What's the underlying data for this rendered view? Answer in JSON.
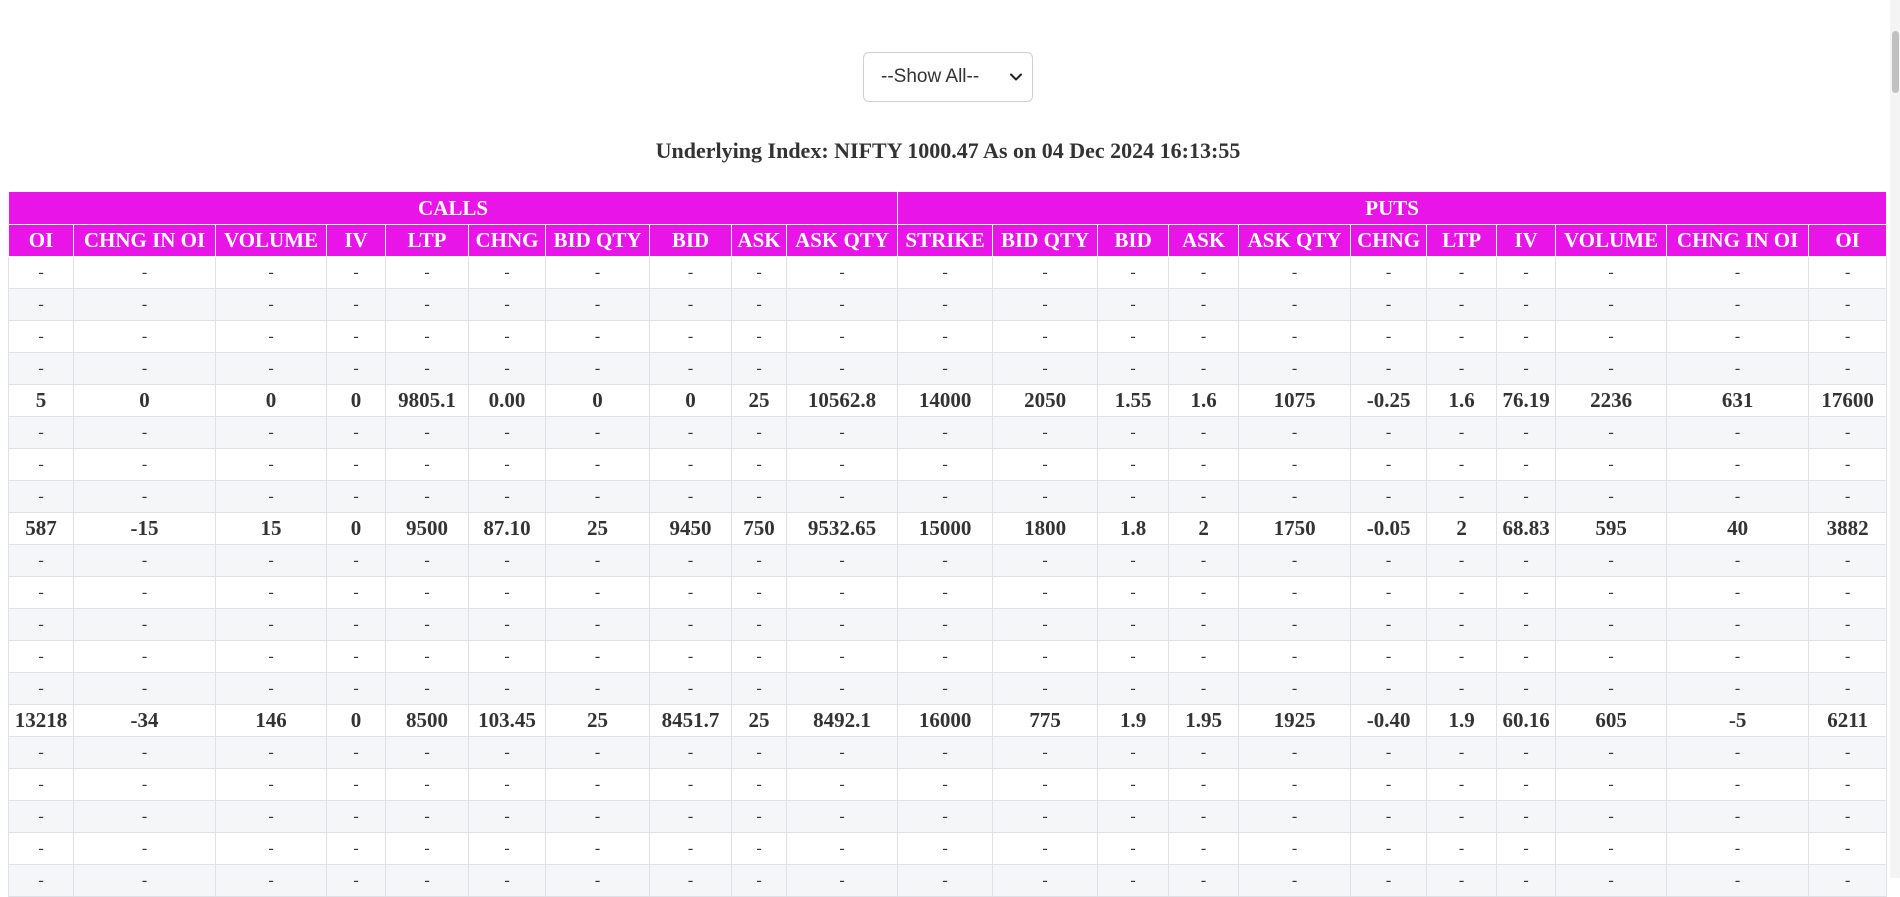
{
  "filter": {
    "selected": "--Show All--"
  },
  "title": "Underlying Index: NIFTY 1000.47 As on 04 Dec 2024 16:13:55",
  "table": {
    "groups": [
      "CALLS",
      "PUTS"
    ],
    "columns": [
      "OI",
      "CHNG IN OI",
      "VOLUME",
      "IV",
      "LTP",
      "CHNG",
      "BID QTY",
      "BID",
      "ASK",
      "ASK QTY",
      "STRIKE",
      "BID QTY",
      "BID",
      "ASK",
      "ASK QTY",
      "CHNG",
      "LTP",
      "IV",
      "VOLUME",
      "CHNG IN OI",
      "OI"
    ],
    "rows": [
      [
        "-",
        "-",
        "-",
        "-",
        "-",
        "-",
        "-",
        "-",
        "-",
        "-",
        "-",
        "-",
        "-",
        "-",
        "-",
        "-",
        "-",
        "-",
        "-",
        "-",
        "-"
      ],
      [
        "-",
        "-",
        "-",
        "-",
        "-",
        "-",
        "-",
        "-",
        "-",
        "-",
        "-",
        "-",
        "-",
        "-",
        "-",
        "-",
        "-",
        "-",
        "-",
        "-",
        "-"
      ],
      [
        "-",
        "-",
        "-",
        "-",
        "-",
        "-",
        "-",
        "-",
        "-",
        "-",
        "-",
        "-",
        "-",
        "-",
        "-",
        "-",
        "-",
        "-",
        "-",
        "-",
        "-"
      ],
      [
        "-",
        "-",
        "-",
        "-",
        "-",
        "-",
        "-",
        "-",
        "-",
        "-",
        "-",
        "-",
        "-",
        "-",
        "-",
        "-",
        "-",
        "-",
        "-",
        "-",
        "-"
      ],
      [
        "5",
        "0",
        "0",
        "0",
        "9805.1",
        "0.00",
        "0",
        "0",
        "25",
        "10562.8",
        "14000",
        "2050",
        "1.55",
        "1.6",
        "1075",
        "-0.25",
        "1.6",
        "76.19",
        "2236",
        "631",
        "17600"
      ],
      [
        "-",
        "-",
        "-",
        "-",
        "-",
        "-",
        "-",
        "-",
        "-",
        "-",
        "-",
        "-",
        "-",
        "-",
        "-",
        "-",
        "-",
        "-",
        "-",
        "-",
        "-"
      ],
      [
        "-",
        "-",
        "-",
        "-",
        "-",
        "-",
        "-",
        "-",
        "-",
        "-",
        "-",
        "-",
        "-",
        "-",
        "-",
        "-",
        "-",
        "-",
        "-",
        "-",
        "-"
      ],
      [
        "-",
        "-",
        "-",
        "-",
        "-",
        "-",
        "-",
        "-",
        "-",
        "-",
        "-",
        "-",
        "-",
        "-",
        "-",
        "-",
        "-",
        "-",
        "-",
        "-",
        "-"
      ],
      [
        "587",
        "-15",
        "15",
        "0",
        "9500",
        "87.10",
        "25",
        "9450",
        "750",
        "9532.65",
        "15000",
        "1800",
        "1.8",
        "2",
        "1750",
        "-0.05",
        "2",
        "68.83",
        "595",
        "40",
        "3882"
      ],
      [
        "-",
        "-",
        "-",
        "-",
        "-",
        "-",
        "-",
        "-",
        "-",
        "-",
        "-",
        "-",
        "-",
        "-",
        "-",
        "-",
        "-",
        "-",
        "-",
        "-",
        "-"
      ],
      [
        "-",
        "-",
        "-",
        "-",
        "-",
        "-",
        "-",
        "-",
        "-",
        "-",
        "-",
        "-",
        "-",
        "-",
        "-",
        "-",
        "-",
        "-",
        "-",
        "-",
        "-"
      ],
      [
        "-",
        "-",
        "-",
        "-",
        "-",
        "-",
        "-",
        "-",
        "-",
        "-",
        "-",
        "-",
        "-",
        "-",
        "-",
        "-",
        "-",
        "-",
        "-",
        "-",
        "-"
      ],
      [
        "-",
        "-",
        "-",
        "-",
        "-",
        "-",
        "-",
        "-",
        "-",
        "-",
        "-",
        "-",
        "-",
        "-",
        "-",
        "-",
        "-",
        "-",
        "-",
        "-",
        "-"
      ],
      [
        "-",
        "-",
        "-",
        "-",
        "-",
        "-",
        "-",
        "-",
        "-",
        "-",
        "-",
        "-",
        "-",
        "-",
        "-",
        "-",
        "-",
        "-",
        "-",
        "-",
        "-"
      ],
      [
        "13218",
        "-34",
        "146",
        "0",
        "8500",
        "103.45",
        "25",
        "8451.7",
        "25",
        "8492.1",
        "16000",
        "775",
        "1.9",
        "1.95",
        "1925",
        "-0.40",
        "1.9",
        "60.16",
        "605",
        "-5",
        "6211"
      ],
      [
        "-",
        "-",
        "-",
        "-",
        "-",
        "-",
        "-",
        "-",
        "-",
        "-",
        "-",
        "-",
        "-",
        "-",
        "-",
        "-",
        "-",
        "-",
        "-",
        "-",
        "-"
      ],
      [
        "-",
        "-",
        "-",
        "-",
        "-",
        "-",
        "-",
        "-",
        "-",
        "-",
        "-",
        "-",
        "-",
        "-",
        "-",
        "-",
        "-",
        "-",
        "-",
        "-",
        "-"
      ],
      [
        "-",
        "-",
        "-",
        "-",
        "-",
        "-",
        "-",
        "-",
        "-",
        "-",
        "-",
        "-",
        "-",
        "-",
        "-",
        "-",
        "-",
        "-",
        "-",
        "-",
        "-"
      ],
      [
        "-",
        "-",
        "-",
        "-",
        "-",
        "-",
        "-",
        "-",
        "-",
        "-",
        "-",
        "-",
        "-",
        "-",
        "-",
        "-",
        "-",
        "-",
        "-",
        "-",
        "-"
      ],
      [
        "-",
        "-",
        "-",
        "-",
        "-",
        "-",
        "-",
        "-",
        "-",
        "-",
        "-",
        "-",
        "-",
        "-",
        "-",
        "-",
        "-",
        "-",
        "-",
        "-",
        "-"
      ]
    ]
  },
  "colors": {
    "header_bg": "#e814e8",
    "header_text": "#ffffff",
    "stripe": "#f5f6f8"
  }
}
